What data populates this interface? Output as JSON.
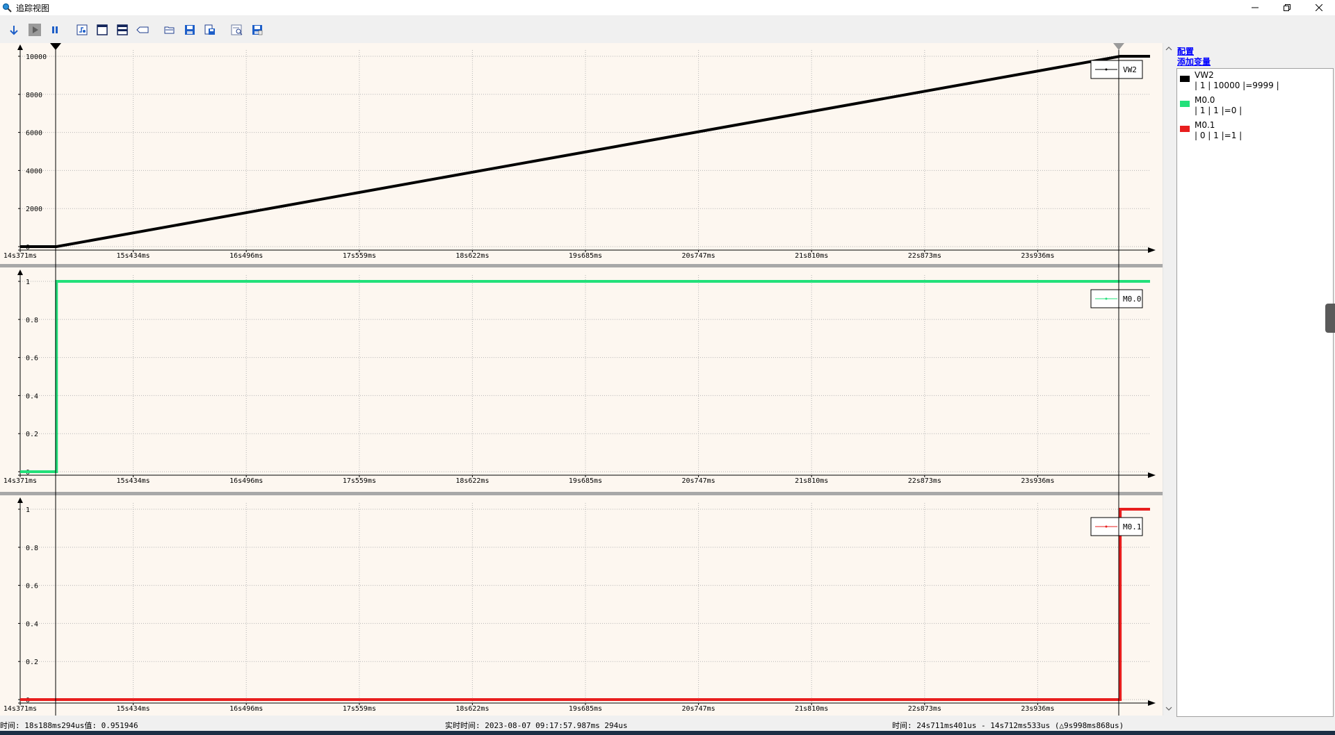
{
  "window": {
    "title": "追踪视图",
    "buttons": [
      "minimize",
      "restore",
      "close"
    ]
  },
  "toolbar": {
    "buttons": [
      {
        "name": "download-button",
        "icon": "arrow-down-icon"
      },
      {
        "name": "run-button",
        "icon": "play-icon"
      },
      {
        "name": "pause-button",
        "icon": "pause-icon"
      },
      {
        "name": "trigger-button",
        "icon": "trigger-icon"
      },
      {
        "name": "single-view-button",
        "icon": "window-icon"
      },
      {
        "name": "split-view-button",
        "icon": "split-window-icon"
      },
      {
        "name": "tag-button",
        "icon": "tag-icon"
      },
      {
        "name": "open-button",
        "icon": "folder-open-icon"
      },
      {
        "name": "save-button",
        "icon": "save-icon"
      },
      {
        "name": "export-button",
        "icon": "export-icon"
      },
      {
        "name": "print-preview-button",
        "icon": "print-preview-icon"
      },
      {
        "name": "save-as-button",
        "icon": "save-as-icon"
      }
    ]
  },
  "right_panel": {
    "config_link": "配置",
    "add_variable_link": "添加变量",
    "variables": [
      {
        "name": "VW2",
        "stats": "| 1 | 10000 |=9999 |",
        "color": "#000000"
      },
      {
        "name": "M0.0",
        "stats": "| 1 | 1 |=0 |",
        "color": "#22e07a"
      },
      {
        "name": "M0.1",
        "stats": "| 0 | 1 |=1 |",
        "color": "#e81e1e"
      }
    ]
  },
  "chart_data": [
    {
      "type": "line",
      "series": [
        {
          "name": "VW2",
          "color": "#000000",
          "x": [
            "14s371ms",
            "14s712ms533us",
            "24s711ms401us",
            "25s000ms"
          ],
          "values": [
            0,
            0,
            10000,
            10000
          ]
        }
      ],
      "legend": "VW2",
      "x_tick_labels": [
        "14s371ms",
        "15s434ms",
        "16s496ms",
        "17s559ms",
        "18s622ms",
        "19s685ms",
        "20s747ms",
        "21s810ms",
        "22s873ms",
        "23s936ms"
      ],
      "y_tick_labels": [
        "0",
        "2000",
        "4000",
        "6000",
        "8000",
        "10000"
      ],
      "ylim": [
        0,
        10000
      ],
      "grid": true
    },
    {
      "type": "line",
      "series": [
        {
          "name": "M0.0",
          "color": "#22e07a",
          "x": [
            "14s371ms",
            "14s712ms533us",
            "14s712ms533us",
            "25s000ms"
          ],
          "values": [
            0,
            0,
            1,
            1
          ]
        }
      ],
      "legend": "M0.0",
      "x_tick_labels": [
        "14s371ms",
        "15s434ms",
        "16s496ms",
        "17s559ms",
        "18s622ms",
        "19s685ms",
        "20s747ms",
        "21s810ms",
        "22s873ms",
        "23s936ms"
      ],
      "y_tick_labels": [
        "0",
        "0.2",
        "0.4",
        "0.6",
        "0.8",
        "1"
      ],
      "ylim": [
        0,
        1
      ],
      "grid": true
    },
    {
      "type": "line",
      "series": [
        {
          "name": "M0.1",
          "color": "#e81e1e",
          "x": [
            "14s371ms",
            "24s711ms401us",
            "24s711ms401us",
            "25s000ms"
          ],
          "values": [
            0,
            0,
            1,
            1
          ]
        }
      ],
      "legend": "M0.1",
      "x_tick_labels": [
        "14s371ms",
        "15s434ms",
        "16s496ms",
        "17s559ms",
        "18s622ms",
        "19s685ms",
        "20s747ms",
        "21s810ms",
        "22s873ms",
        "23s936ms"
      ],
      "y_tick_labels": [
        "0",
        "0.2",
        "0.4",
        "0.6",
        "0.8",
        "1"
      ],
      "ylim": [
        0,
        1
      ],
      "grid": true
    }
  ],
  "status": {
    "cursor_time": "时间: 18s188ms294us值: 0.951946",
    "realtime": "实时时间: 2023-08-07 09:17:57.987ms 294us",
    "delta": "时间: 24s711ms401us - 14s712ms533us (△9s998ms868us)"
  },
  "colors": {
    "plot_bg": "#fdf7f0",
    "grid": "#b5b5b5",
    "separator": "#a8a8a8",
    "link": "#0000ff"
  }
}
